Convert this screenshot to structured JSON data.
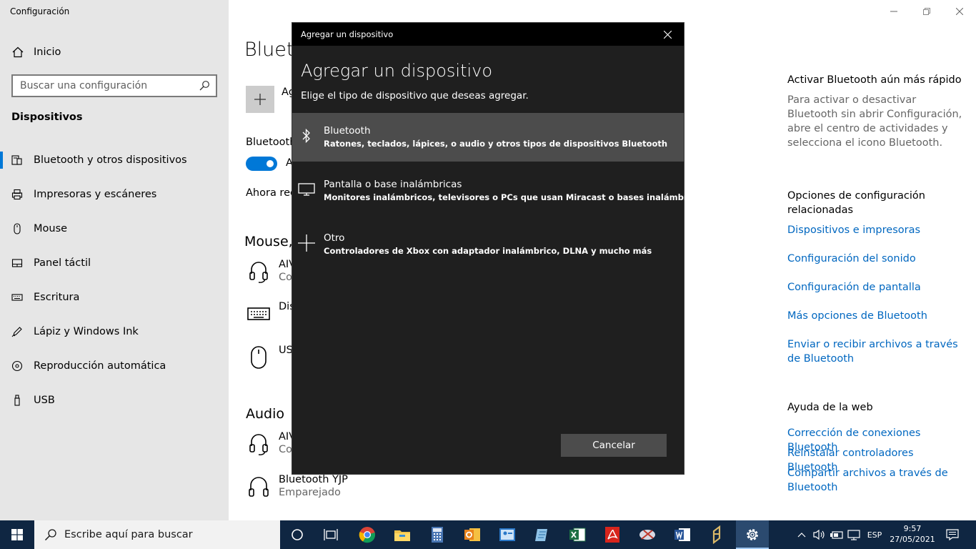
{
  "window": {
    "title": "Configuración"
  },
  "sidebar": {
    "home_label": "Inicio",
    "search_placeholder": "Buscar una configuración",
    "section": "Dispositivos",
    "items": [
      {
        "label": "Bluetooth y otros dispositivos",
        "icon": "bluetooth-devices-icon"
      },
      {
        "label": "Impresoras y escáneres",
        "icon": "printer-icon"
      },
      {
        "label": "Mouse",
        "icon": "mouse-icon"
      },
      {
        "label": "Panel táctil",
        "icon": "touchpad-icon"
      },
      {
        "label": "Escritura",
        "icon": "keyboard-icon"
      },
      {
        "label": "Lápiz y Windows Ink",
        "icon": "pen-icon"
      },
      {
        "label": "Reproducción automática",
        "icon": "autoplay-icon"
      },
      {
        "label": "USB",
        "icon": "usb-icon"
      }
    ]
  },
  "main": {
    "title": "Bluetooth y otros dispositivos",
    "add_label": "Ag",
    "bluetooth_label": "Bluetooth",
    "toggle_state": "A",
    "discoverable": "Ahora rec",
    "mouse_section": "Mouse,",
    "audio_section": "Audio",
    "devices_top": [
      {
        "name": "AIV",
        "status": "Co",
        "icon": "headset-icon"
      },
      {
        "name": "Dis",
        "status": "",
        "icon": "keyboard-icon"
      },
      {
        "name": "US",
        "status": "",
        "icon": "mouse-icon"
      }
    ],
    "devices_audio": [
      {
        "name": "AIV",
        "status": "Co",
        "icon": "headset-icon"
      },
      {
        "name": "Bluetooth  YJP",
        "status": "Emparejado",
        "icon": "headphones-icon"
      }
    ]
  },
  "right": {
    "quick_heading": "Activar Bluetooth aún más rápido",
    "quick_text": "Para activar o desactivar Bluetooth sin abrir Configuración, abre el centro de actividades y selecciona el icono Bluetooth.",
    "related_heading": "Opciones de configuración relacionadas",
    "related_links": [
      "Dispositivos e impresoras",
      "Configuración del sonido",
      "Configuración de pantalla",
      "Más opciones de Bluetooth",
      "Enviar o recibir archivos a través de Bluetooth"
    ],
    "help_heading": "Ayuda de la web",
    "help_links": [
      "Corrección de conexiones Bluetooth",
      "Reinstalar controladores Bluetooth",
      "Compartir archivos a través de Bluetooth"
    ]
  },
  "dialog": {
    "window_title": "Agregar un dispositivo",
    "title": "Agregar un dispositivo",
    "subtitle": "Elige el tipo de dispositivo que deseas agregar.",
    "options": [
      {
        "name": "Bluetooth",
        "desc": "Ratones, teclados, lápices, o audio y otros tipos de dispositivos Bluetooth",
        "icon": "bluetooth-icon"
      },
      {
        "name": "Pantalla o base inalámbricas",
        "desc": "Monitores inalámbricos, televisores o PCs que usan Miracast o bases inalámbricas",
        "icon": "monitor-icon"
      },
      {
        "name": "Otro",
        "desc": "Controladores de Xbox con adaptador inalámbrico, DLNA y mucho más",
        "icon": "plus-icon"
      }
    ],
    "cancel": "Cancelar"
  },
  "taskbar": {
    "search_placeholder": "Escribe aquí para buscar",
    "apps": [
      "cortana-icon",
      "task-view-icon",
      "chrome-icon",
      "file-explorer-icon",
      "calculator-icon",
      "outlook-icon",
      "contacts-icon",
      "notes-icon",
      "excel-icon",
      "acrobat-icon",
      "snipping-icon",
      "word-icon",
      "autocad-icon",
      "settings-icon"
    ],
    "language": "ESP",
    "time": "9:57",
    "date": "27/05/2021"
  },
  "colors": {
    "accent": "#0078d7",
    "link": "#0067c0",
    "taskbar": "#0f2642",
    "dialog": "#1f1f1f"
  }
}
